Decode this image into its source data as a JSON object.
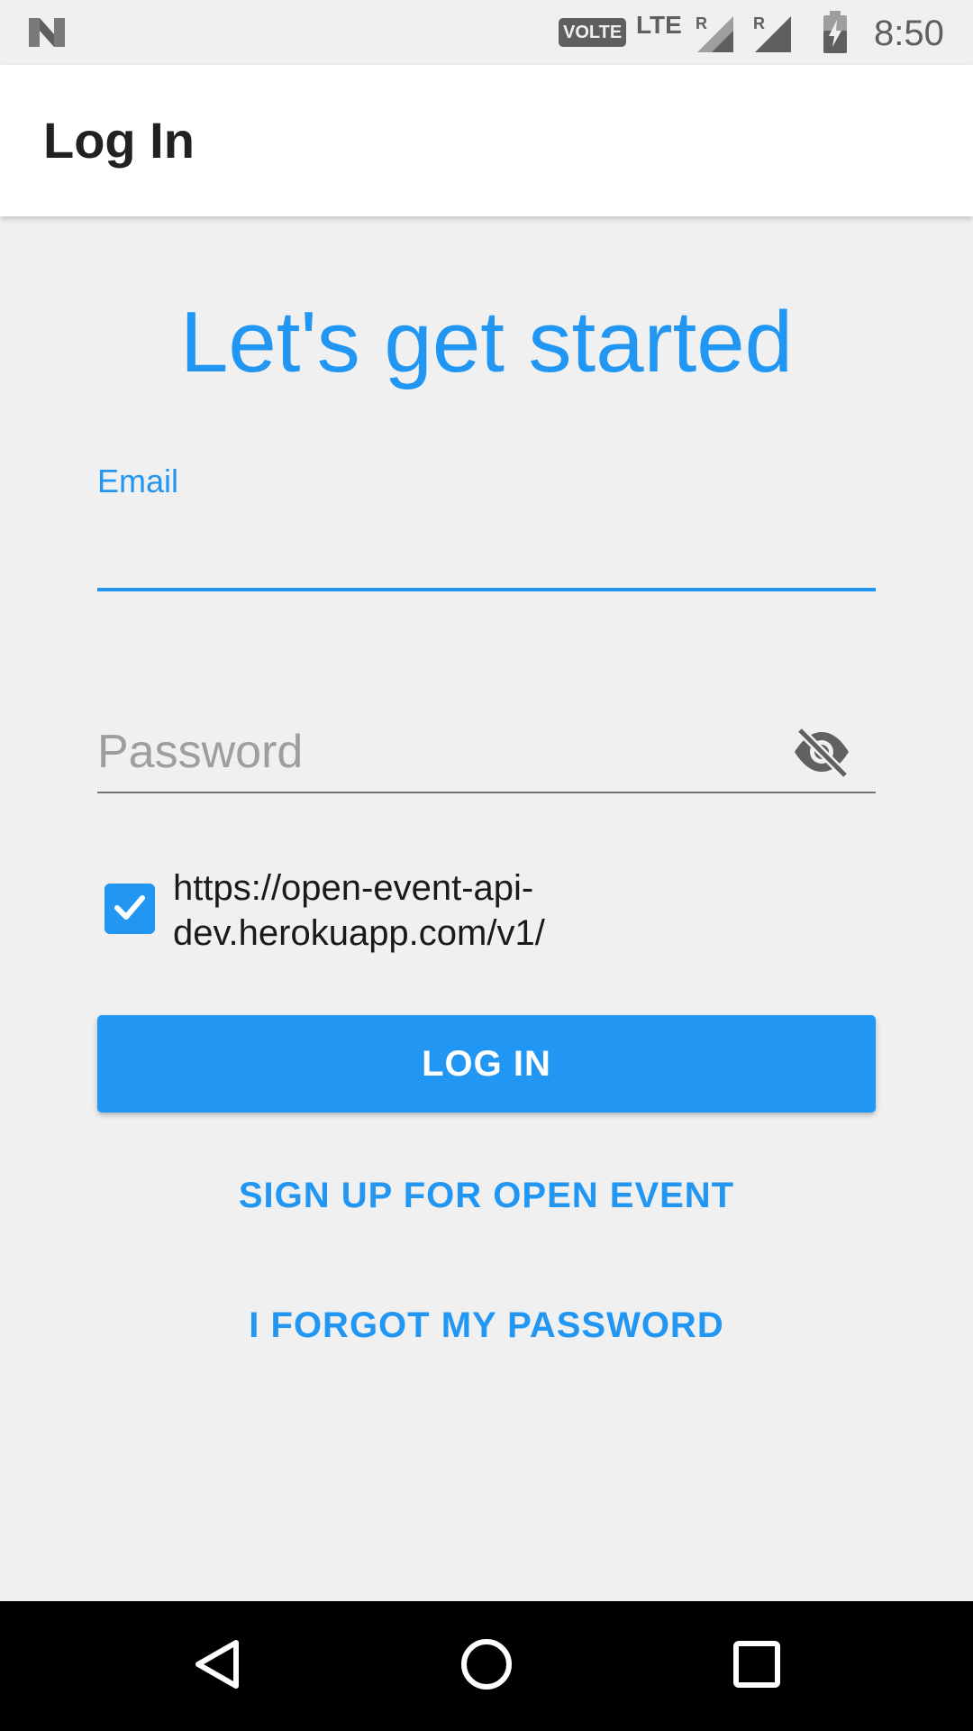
{
  "status_bar": {
    "network_badge": "VOLTE",
    "network_type": "LTE",
    "roaming_1": "R",
    "roaming_2": "R",
    "time": "8:50",
    "icon_color": "#5f5f5f"
  },
  "app_bar": {
    "title": "Log In"
  },
  "main": {
    "headline": "Let's get started",
    "email": {
      "label": "Email",
      "value": ""
    },
    "password": {
      "placeholder": "Password",
      "value": "",
      "visibility_icon": "visibility-off-icon"
    },
    "api_url": {
      "checked": true,
      "text": "https://open-event-api-dev.herokuapp.com/v1/"
    },
    "login_label": "LOG IN",
    "signup_label": "SIGN UP FOR OPEN EVENT",
    "forgot_label": "I FORGOT MY PASSWORD"
  },
  "colors": {
    "accent": "#2196f3",
    "background": "#f0f0f0",
    "app_bar": "#ffffff",
    "nav_bar": "#000000"
  },
  "nav_bar": {
    "icons": [
      "back-icon",
      "home-icon",
      "recent-apps-icon"
    ]
  }
}
